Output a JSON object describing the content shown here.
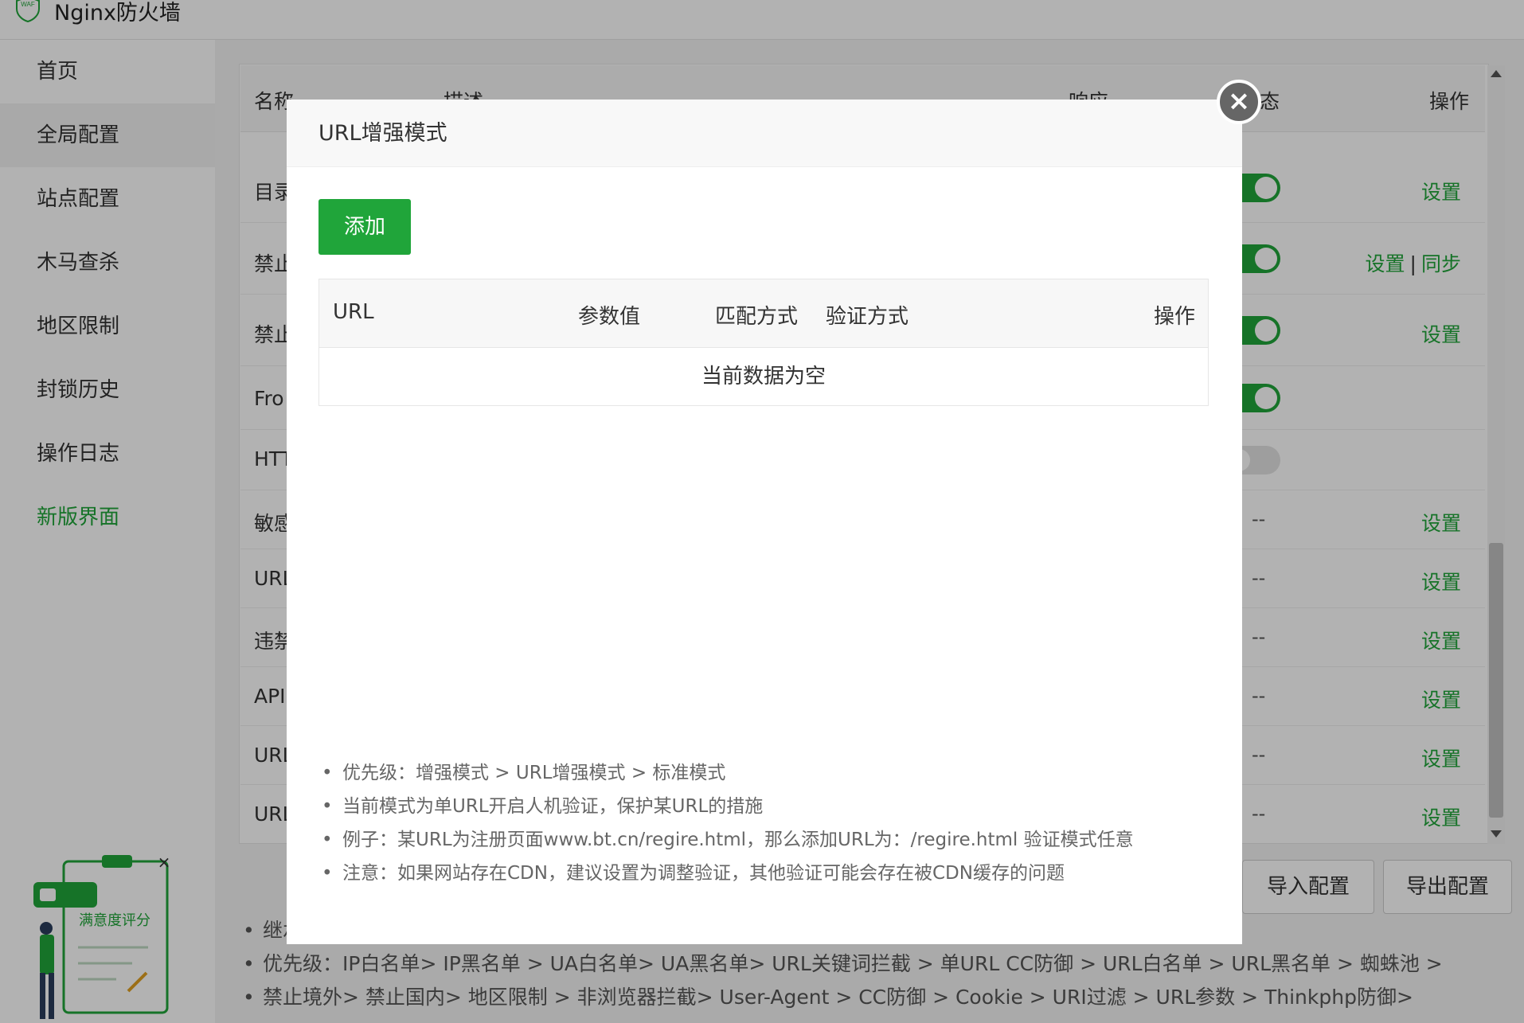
{
  "app": {
    "title": "Nginx防火墙",
    "logo_text": "WAF"
  },
  "sidebar": {
    "items": [
      {
        "label": "首页"
      },
      {
        "label": "全局配置"
      },
      {
        "label": "站点配置"
      },
      {
        "label": "木马查杀"
      },
      {
        "label": "地区限制"
      },
      {
        "label": "封锁历史"
      },
      {
        "label": "操作日志"
      },
      {
        "label": "新版界面"
      }
    ]
  },
  "table": {
    "headers": {
      "name": "名称",
      "desc": "描述",
      "response": "响应",
      "status": "态",
      "action": "操作"
    },
    "rows": [
      {
        "name": "目录",
        "action": "设置",
        "status": "on"
      },
      {
        "name": "禁止",
        "action": "设置",
        "action2": "同步",
        "separator": "|",
        "status": "on"
      },
      {
        "name": "禁止",
        "action": "设置",
        "status": "on"
      },
      {
        "name": "Fro",
        "status": "on"
      },
      {
        "name": "HTT",
        "status": "off"
      },
      {
        "name": "敏感",
        "dash": "--",
        "action": "设置"
      },
      {
        "name": "URL",
        "dash": "--",
        "action": "设置"
      },
      {
        "name": "违禁",
        "dash": "--",
        "action": "设置"
      },
      {
        "name": "API",
        "dash": "--",
        "action": "设置"
      },
      {
        "name": "URL",
        "dash": "--",
        "action": "设置"
      },
      {
        "name": "URL",
        "dash": "--",
        "action": "设置"
      }
    ]
  },
  "buttons": {
    "import": "导入配置",
    "export": "导出配置"
  },
  "notes": [
    "继承",
    "优先级：IP白名单> IP黑名单 > UA白名单> UA黑名单> URL关键词拦截 > 单URL CC防御 > URL白名单 > URL黑名单 > 蜘蛛池 >",
    "禁止境外> 禁止国内> 地区限制 > 非浏览器拦截> User-Agent > CC防御 > Cookie > URI过滤 > URL参数 > Thinkphp防御>"
  ],
  "rating_widget": {
    "label": "满意度评分",
    "close": "×"
  },
  "modal": {
    "title": "URL增强模式",
    "close": "×",
    "add_label": "添加",
    "table_headers": {
      "url": "URL",
      "param": "参数值",
      "match": "匹配方式",
      "verify": "验证方式",
      "action": "操作"
    },
    "empty_text": "当前数据为空",
    "notes": [
      "优先级：增强模式 > URL增强模式 > 标准模式",
      "当前模式为单URL开启人机验证，保护某URL的措施",
      "例子：某URL为注册页面www.bt.cn/regire.html，那么添加URL为：/regire.html 验证模式任意",
      "注意：如果网站存在CDN，建议设置为调整验证，其他验证可能会存在被CDN缓存的问题"
    ]
  },
  "colors": {
    "brand": "#20a53a",
    "overlay": "rgba(0,0,0,0.3)"
  }
}
